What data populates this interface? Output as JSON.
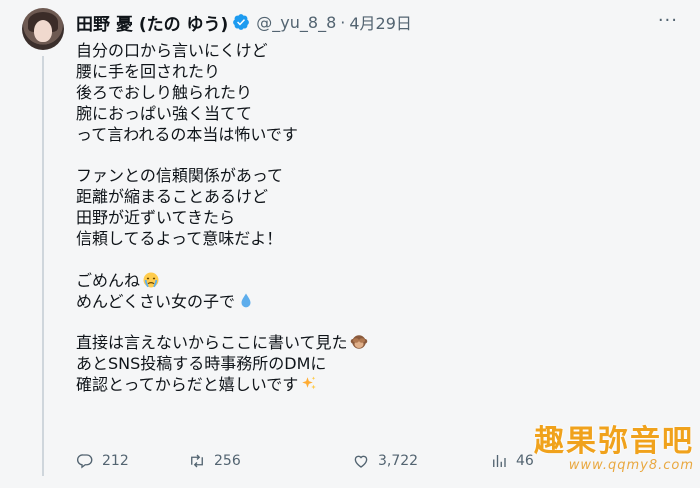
{
  "tweet": {
    "author_name": "田野 憂 (たの ゆう)",
    "handle": "@_yu_8_8",
    "separator": "·",
    "date": "4月29日",
    "more": "···",
    "lines": [
      "自分の口から言いにくけど",
      "腰に手を回されたり",
      "後ろでおしり触られたり",
      "腕におっぱい強く当てて",
      "って言われるの本当は怖いです",
      "",
      "ファンとの信頼関係があって",
      "距離が縮まることあるけど",
      "田野が近ずいてきたら",
      "信頼してるよって意味だよ！",
      "",
      "ごめんね",
      "めんどくさい女の子で",
      "",
      "直接は言えないからここに書いて見た",
      "あとSNS投稿する時事務所のDMに",
      "確認とってからだと嬉しいです"
    ],
    "line_emojis": {
      "11": "crying-face-emoji",
      "12": "droplet-emoji",
      "14": "see-no-evil-monkey-emoji",
      "16": "sparkles-emoji"
    }
  },
  "actions": {
    "reply_count": "212",
    "retweet_count": "256",
    "like_count": "3,722",
    "views_count": "46"
  },
  "watermark": {
    "title": "趣果弥音吧",
    "url": "www.qqmy8.com"
  },
  "colors": {
    "text": "#0f1419",
    "muted": "#536471",
    "verified": "#1d9bf0",
    "watermark": "#f0a21c"
  }
}
